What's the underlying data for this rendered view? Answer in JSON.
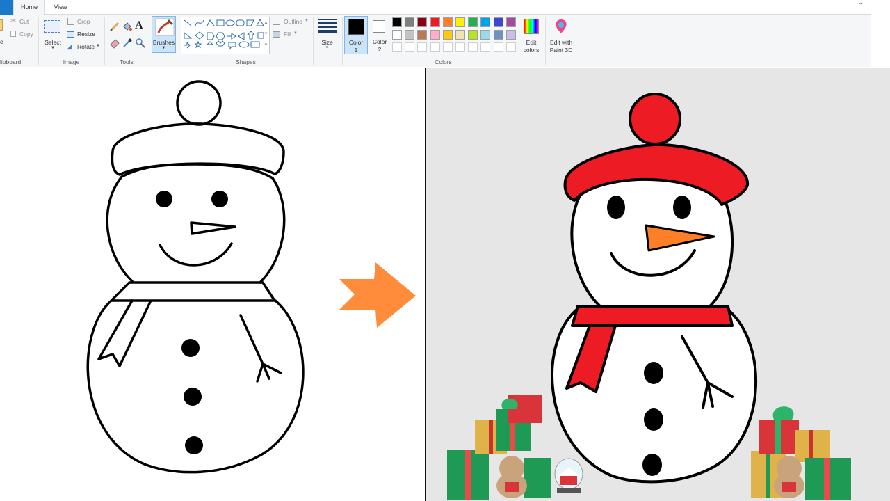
{
  "tabs": {
    "home": "Home",
    "view": "View"
  },
  "clipboard": {
    "paste_partial": "e",
    "cut": "Cut",
    "copy": "Copy",
    "label": "lipboard"
  },
  "image": {
    "select": "Select",
    "crop": "Crop",
    "resize": "Resize",
    "rotate": "Rotate",
    "label": "Image"
  },
  "tools": {
    "label": "Tools",
    "text_glyph": "A"
  },
  "brushes": {
    "label": "Brushes"
  },
  "shapes": {
    "outline": "Outline",
    "fill": "Fill",
    "label": "Shapes"
  },
  "size": {
    "label": "Size"
  },
  "color1": {
    "line1": "Color",
    "line2": "1",
    "value": "#000000"
  },
  "color2": {
    "line1": "Color",
    "line2": "2",
    "value": "#ffffff"
  },
  "colors": {
    "label": "Colors",
    "edit_line1": "Edit",
    "edit_line2": "colors",
    "paint3d_line1": "Edit with",
    "paint3d_line2": "Paint 3D",
    "palette_row1": [
      "#000000",
      "#7f7f7f",
      "#880015",
      "#ed1c24",
      "#ff7f27",
      "#fff200",
      "#22b14c",
      "#00a2e8",
      "#3f48cc",
      "#a349a4"
    ],
    "palette_row2": [
      "#ffffff",
      "#c3c3c3",
      "#b97a57",
      "#ffaec9",
      "#ffc90e",
      "#efe4b0",
      "#b5e61d",
      "#99d9ea",
      "#7092be",
      "#c8bfe7"
    ]
  },
  "drawing": {
    "hat_color": "#ed1c24",
    "scarf_color": "#ed1c24",
    "nose_color": "#ff7f27",
    "arrow_color": "#ff8c3a",
    "right_bg": "#e6e6e6"
  }
}
